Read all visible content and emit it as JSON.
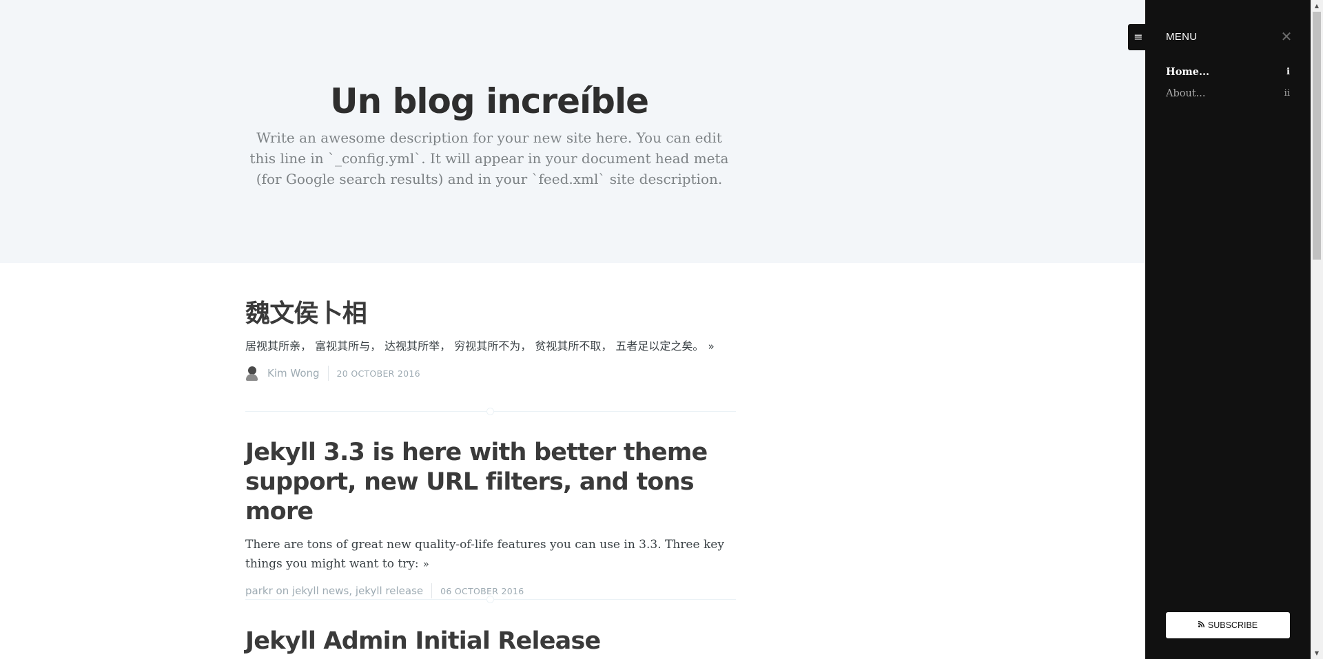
{
  "header": {
    "title": "Un blog increíble",
    "description": "Write an awesome description for your new site here. You can edit this line in `_config.yml`. It will appear in your document head meta (for Google search results) and in your `feed.xml` site description."
  },
  "posts": [
    {
      "title": "魏文侯卜相",
      "excerpt": "居视其所亲， 富视其所与， 达视其所举， 穷视其所不为， 贫视其所不取， 五者足以定之矣。",
      "read_more": "»",
      "author": "Kim Wong",
      "date": "20 October 2016"
    },
    {
      "title": "Jekyll 3.3 is here with better theme support, new URL filters, and tons more",
      "excerpt": "There are tons of great new quality-of-life features you can use in 3.3. Three key things you might want to try:",
      "read_more": "»",
      "author": "parkr",
      "on": "on",
      "tag_1": "jekyll news",
      "tag_sep": ",",
      "tag_2": "jekyll release",
      "date": "06 October 2016"
    },
    {
      "title": "Jekyll Admin Initial Release"
    }
  ],
  "menu_toggle": {
    "icon": "hamburger-icon",
    "glyph": "≡"
  },
  "side_menu": {
    "title": "MENU",
    "close_glyph": "✕",
    "items": [
      {
        "label": "Home...",
        "num": "i",
        "active": true
      },
      {
        "label": "About...",
        "num": "ii",
        "active": false
      }
    ],
    "subscribe_icon": "rss-icon",
    "subscribe_glyph": "ℬ",
    "subscribe_label": "Subscribe"
  },
  "scrollbar": {
    "up_glyph": "▲",
    "down_glyph": "▼"
  },
  "colors": {
    "header_bg": "#f3f6f9",
    "menu_bg": "#111111",
    "meta_text": "#9eabb3"
  }
}
